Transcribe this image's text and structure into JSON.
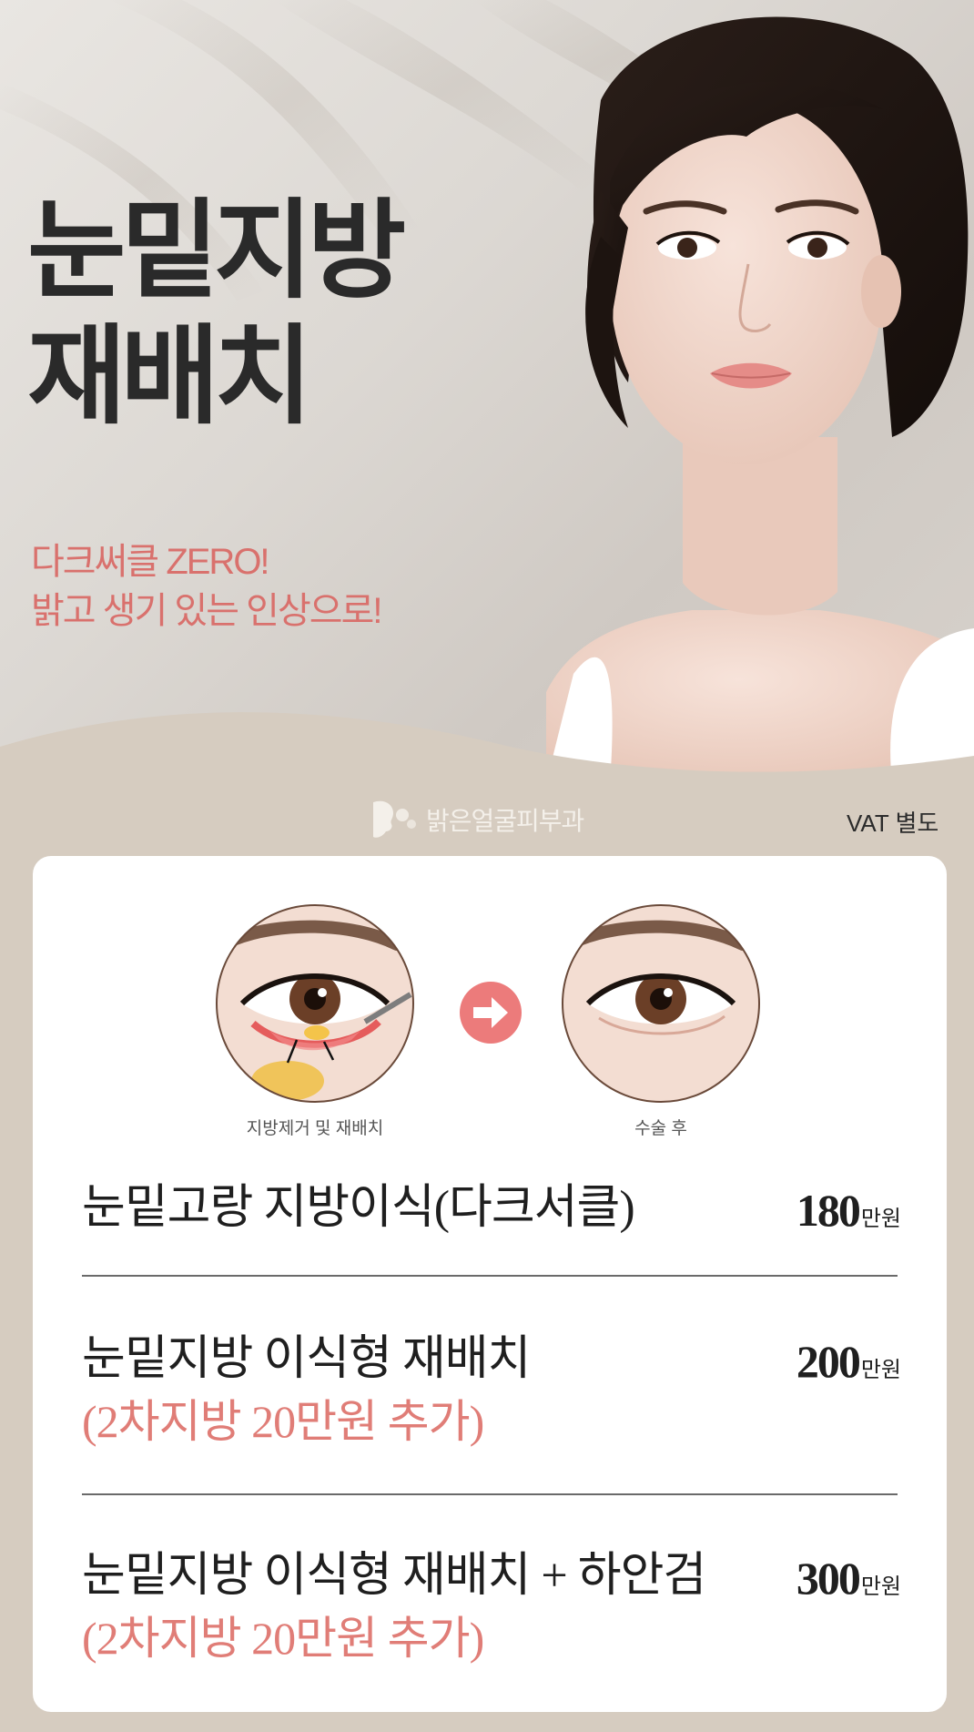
{
  "hero": {
    "headline_line1": "눈밑지방",
    "headline_line2": "재배치",
    "tagline_line1": "다크써클 ZERO!",
    "tagline_line2": "밝고 생기 있는 인상으로!"
  },
  "brand": {
    "logo_text": "밝은얼굴피부과",
    "vat_note": "VAT 별도"
  },
  "illustration": {
    "before_caption": "지방제거 및 재배치",
    "after_caption": "수술 후"
  },
  "price_list": [
    {
      "title": "눈밑고랑 지방이식(다크서클)",
      "note": "",
      "price": "180",
      "unit": "만원"
    },
    {
      "title": "눈밑지방 이식형 재배치",
      "note": "(2차지방 20만원 추가)",
      "price": "200",
      "unit": "만원"
    },
    {
      "title": "눈밑지방 이식형 재배치 + 하안검",
      "note": "(2차지방 20만원 추가)",
      "price": "300",
      "unit": "만원"
    }
  ],
  "colors": {
    "accent": "#e07d77",
    "arrow_badge": "#ec7b7b",
    "background": "#d6ccc0",
    "headline": "#2a2a2a"
  },
  "icons": {
    "logo": "face-profile-icon",
    "arrow": "arrow-right-icon"
  }
}
